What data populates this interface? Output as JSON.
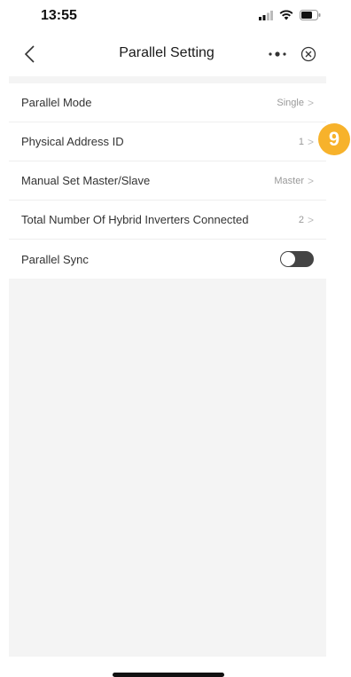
{
  "status_bar": {
    "time": "13:55"
  },
  "nav": {
    "title": "Parallel Setting"
  },
  "settings": [
    {
      "label": "Parallel Mode",
      "value": "Single"
    },
    {
      "label": "Physical Address ID",
      "value": "1"
    },
    {
      "label": "Manual Set Master/Slave",
      "value": "Master"
    },
    {
      "label": "Total Number Of Hybrid Inverters Connected",
      "value": "2"
    },
    {
      "label": "Parallel Sync",
      "toggle_on": false
    }
  ],
  "annotation": {
    "step_number": "9",
    "color": "#f7b22b"
  }
}
